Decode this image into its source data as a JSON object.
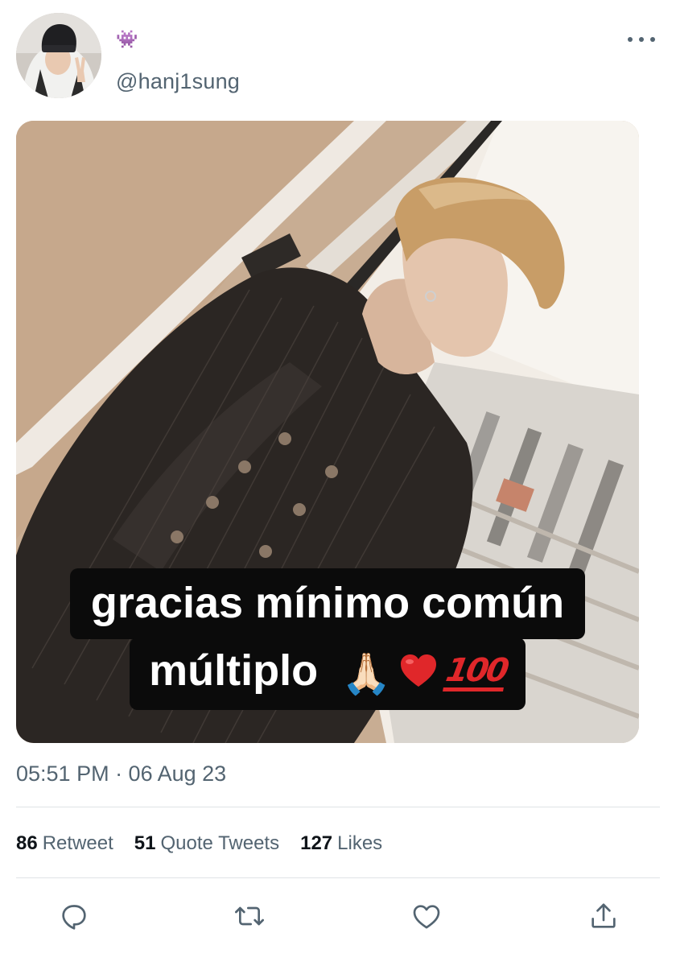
{
  "tweet": {
    "display_name_emoji": "👾",
    "handle": "@hanj1sung",
    "media_caption_line1": "gracias mínimo común",
    "media_caption_line2": "múltiplo",
    "media_caption_emoji_pray": "🙏🏻",
    "media_caption_emoji_hundred": "100",
    "timestamp": "05:51 PM · 06 Aug 23"
  },
  "stats": [
    {
      "count": "86",
      "label": "Retweet"
    },
    {
      "count": "51",
      "label": "Quote Tweets"
    },
    {
      "count": "127",
      "label": "Likes"
    }
  ],
  "icons": {
    "more": "more-horizontal-icon",
    "reply": "reply-icon",
    "retweet": "retweet-icon",
    "like": "heart-icon",
    "share": "share-icon",
    "caption_heart": "red-heart-emoji"
  },
  "colors": {
    "text_primary": "#0f1419",
    "text_secondary": "#536471",
    "divider": "#dfe3e6",
    "caption_bg": "#0b0b0b",
    "heart_red": "#e0272a"
  }
}
